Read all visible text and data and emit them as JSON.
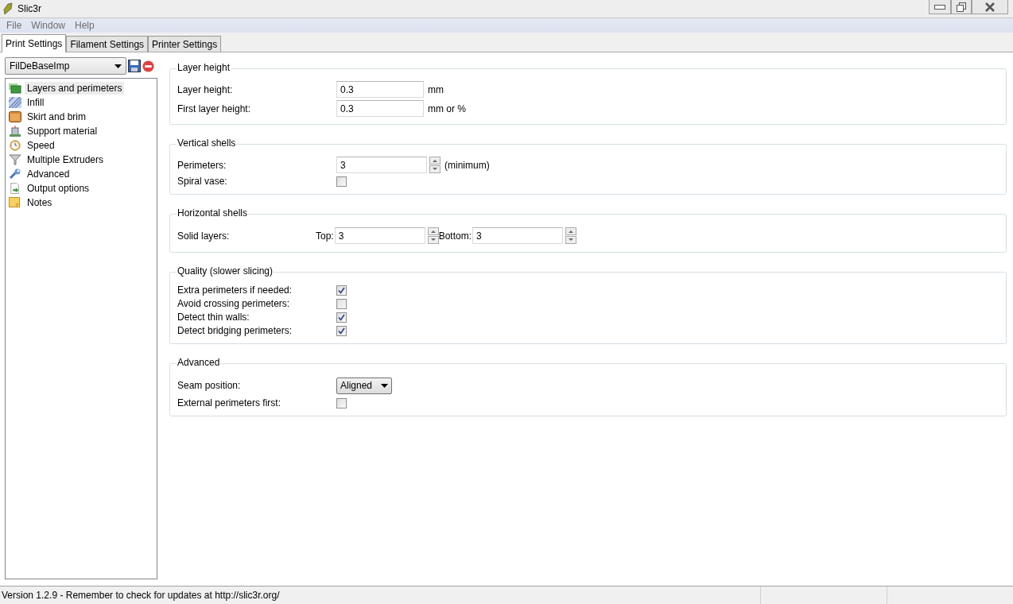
{
  "window": {
    "title": "Slic3r"
  },
  "menu": [
    "File",
    "Window",
    "Help"
  ],
  "tabs": [
    {
      "label": "Print Settings",
      "selected": true
    },
    {
      "label": "Filament Settings",
      "selected": false
    },
    {
      "label": "Printer Settings",
      "selected": false
    }
  ],
  "preset": {
    "value": "FilDeBaseImp"
  },
  "sidebar": {
    "items": [
      {
        "label": "Layers and perimeters",
        "selected": true
      },
      {
        "label": "Infill",
        "selected": false
      },
      {
        "label": "Skirt and brim",
        "selected": false
      },
      {
        "label": "Support material",
        "selected": false
      },
      {
        "label": "Speed",
        "selected": false
      },
      {
        "label": "Multiple Extruders",
        "selected": false
      },
      {
        "label": "Advanced",
        "selected": false
      },
      {
        "label": "Output options",
        "selected": false
      },
      {
        "label": "Notes",
        "selected": false
      }
    ]
  },
  "sections": [
    {
      "title": "Layer height",
      "rows": [
        {
          "kind": "text",
          "label": "Layer height:",
          "value": "0.3",
          "unit": "mm"
        },
        {
          "kind": "text",
          "label": "First layer height:",
          "value": "0.3",
          "unit": "mm or %"
        }
      ]
    },
    {
      "title": "Vertical shells",
      "rows": [
        {
          "kind": "spin",
          "label": "Perimeters:",
          "value": "3",
          "unit": "(minimum)"
        },
        {
          "kind": "checkbox",
          "label": "Spiral vase:",
          "checked": false
        }
      ]
    },
    {
      "title": "Horizontal shells",
      "rows": [
        {
          "kind": "pair",
          "label": "Solid layers:",
          "fields": [
            {
              "label": "Top:",
              "value": "3"
            },
            {
              "label": "Bottom:",
              "value": "3"
            }
          ]
        }
      ]
    },
    {
      "title": "Quality (slower slicing)",
      "rows": [
        {
          "kind": "checkbox",
          "label": "Extra perimeters if needed:",
          "checked": true
        },
        {
          "kind": "checkbox",
          "label": "Avoid crossing perimeters:",
          "checked": false
        },
        {
          "kind": "checkbox",
          "label": "Detect thin walls:",
          "checked": true
        },
        {
          "kind": "checkbox",
          "label": "Detect bridging perimeters:",
          "checked": true
        }
      ]
    },
    {
      "title": "Advanced",
      "rows": [
        {
          "kind": "select",
          "label": "Seam position:",
          "value": "Aligned"
        },
        {
          "kind": "checkbox",
          "label": "External perimeters first:",
          "checked": false
        }
      ]
    }
  ],
  "status_bar": {
    "text": "Version 1.2.9 - Remember to check for updates at http://slic3r.org/"
  }
}
